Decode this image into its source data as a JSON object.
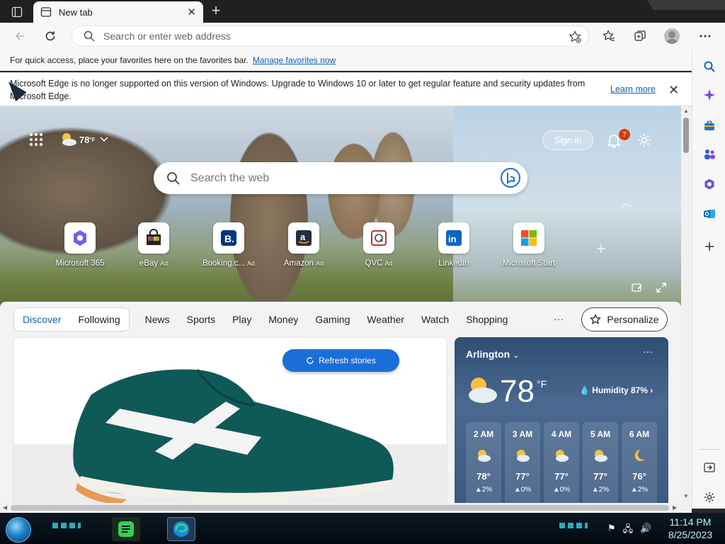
{
  "tab": {
    "title": "New tab",
    "close": "✕"
  },
  "toolbar": {
    "address_placeholder": "Search or enter web address"
  },
  "favbar": {
    "text": "For quick access, place your favorites here on the favorites bar.",
    "link": "Manage favorites now"
  },
  "infobar": {
    "message": "Microsoft Edge is no longer supported on this version of Windows. Upgrade to Windows 10 or later to get regular feature and security updates from Microsoft Edge.",
    "learn_more": "Learn more"
  },
  "hero": {
    "temp": "78",
    "temp_unit": "°F",
    "sign_in": "Sign in",
    "notifications": "7",
    "search_placeholder": "Search the web"
  },
  "quicklinks": [
    {
      "label": "Microsoft 365",
      "ad": ""
    },
    {
      "label": "eBay",
      "ad": "Ad"
    },
    {
      "label": "Booking.c...",
      "ad": "Ad"
    },
    {
      "label": "Amazon",
      "ad": "Ad"
    },
    {
      "label": "QVC",
      "ad": "Ad"
    },
    {
      "label": "LinkedIn",
      "ad": ""
    },
    {
      "label": "Microsoft Start",
      "ad": ""
    }
  ],
  "feed": {
    "discover": "Discover",
    "following": "Following",
    "nav": [
      "News",
      "Sports",
      "Play",
      "Money",
      "Gaming",
      "Weather",
      "Watch",
      "Shopping"
    ],
    "more": "···",
    "personalize": "Personalize",
    "refresh": "Refresh stories"
  },
  "weather": {
    "location": "Arlington",
    "more": "···",
    "temp": "78",
    "unit": "°F",
    "humidity": "Humidity 87%",
    "hourly": [
      {
        "time": "2 AM",
        "temp": "78°",
        "precip": "2%"
      },
      {
        "time": "3 AM",
        "temp": "77°",
        "precip": "0%"
      },
      {
        "time": "4 AM",
        "temp": "77°",
        "precip": "0%"
      },
      {
        "time": "5 AM",
        "temp": "77°",
        "precip": "2%"
      },
      {
        "time": "6 AM",
        "temp": "76°",
        "precip": "2%"
      }
    ]
  },
  "taskbar": {
    "time": "11:14 PM",
    "date": "8/25/2023"
  },
  "colors": {
    "accent": "#0f62b5",
    "refresh_button": "#1a6ed8",
    "badge": "#d83b01"
  }
}
